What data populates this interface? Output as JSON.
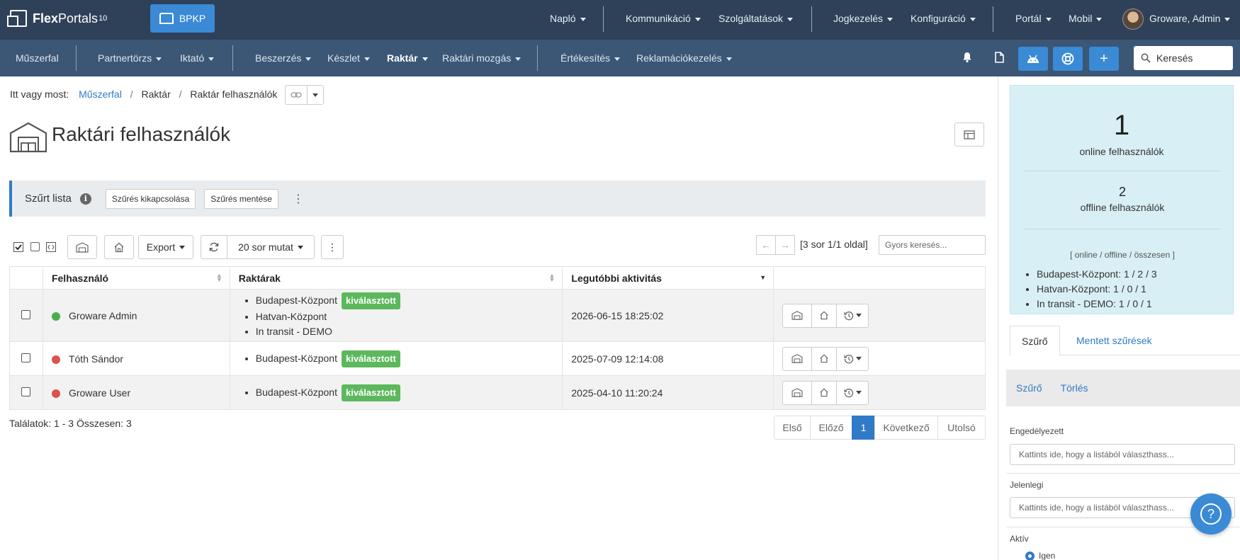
{
  "brand": {
    "name_bold": "Flex",
    "name_rest": "Portals",
    "version": "10"
  },
  "org_button": "BPKP",
  "topnav": [
    {
      "label": "Napló"
    },
    {
      "label": "Kommunikáció"
    },
    {
      "label": "Szolgáltatások"
    },
    {
      "label": "Jogkezelés"
    },
    {
      "label": "Konfiguráció"
    },
    {
      "label": "Portál"
    },
    {
      "label": "Mobil"
    },
    {
      "label": "Groware, Admin"
    }
  ],
  "subnav": [
    {
      "label": "Műszerfal"
    },
    {
      "label": "Partnertörzs"
    },
    {
      "label": "Iktató"
    },
    {
      "label": "Beszerzés"
    },
    {
      "label": "Készlet"
    },
    {
      "label": "Raktár"
    },
    {
      "label": "Raktári mozgás"
    },
    {
      "label": "Értékesítés"
    },
    {
      "label": "Reklamációkezelés"
    }
  ],
  "search": {
    "placeholder": "Keresés"
  },
  "breadcrumb": {
    "prefix": "Itt vagy most:",
    "items": [
      "Műszerfal",
      "Raktár",
      "Raktár felhasználók"
    ]
  },
  "page_title": "Raktári felhasználók",
  "filter_bar": {
    "label": "Szűrt lista",
    "disable_btn": "Szűrés kikapcsolása",
    "save_btn": "Szűrés mentése"
  },
  "toolbar": {
    "export": "Export",
    "rows": "20 sor mutat",
    "rowcount": "[3 sor 1/1 oldal]",
    "quick_search_placeholder": "Gyors keresés..."
  },
  "table": {
    "headers": [
      "Felhasználó",
      "Raktárak",
      "Legutóbbi aktivitás"
    ],
    "badge_text": "kiválasztott",
    "rows": [
      {
        "user": "Groware Admin",
        "status_color": "#4cae4c",
        "warehouses": [
          "Budapest-Központ",
          "Hatvan-Központ",
          "In transit - DEMO"
        ],
        "activity": "2026-06-15 18:25:02"
      },
      {
        "user": "Tóth Sándor",
        "status_color": "#d9534f",
        "warehouses": [
          "Budapest-Központ"
        ],
        "activity": "2025-07-09 12:14:08"
      },
      {
        "user": "Groware User",
        "status_color": "#d9534f",
        "warehouses": [
          "Budapest-Központ"
        ],
        "activity": "2025-04-10 11:20:24"
      }
    ]
  },
  "results": "Találatok: 1 - 3 Összesen: 3",
  "pagination": {
    "first": "Első",
    "prev": "Előző",
    "current": "1",
    "next": "Következő",
    "last": "Utolsó"
  },
  "stats": {
    "online_count": "1",
    "online_label": "online felhasználók",
    "offline_count": "2",
    "offline_label": "offline felhasználók",
    "legend": "[ online / offline / összesen ]",
    "warehouses": [
      "Budapest-Központ: 1 / 2 / 3",
      "Hatvan-Központ: 1 / 0 / 1",
      "In transit - DEMO: 1 / 0 / 1"
    ]
  },
  "right_tabs": {
    "filter": "Szűrő",
    "saved": "Mentett szűrések"
  },
  "filter_actions": {
    "filter": "Szűrő",
    "clear": "Törlés"
  },
  "fields": {
    "allowed_label": "Engedélyezett",
    "allowed_placeholder": "Kattints ide, hogy a listából választhass...",
    "current_label": "Jelenlegi",
    "current_placeholder": "Kattints ide, hogy a listából választhass...",
    "active_label": "Aktív",
    "active_option": "Igen"
  },
  "colors": {
    "topbar": "#2f4159",
    "subbar": "#3c5676",
    "accent": "#3a8ad6",
    "badge": "#5cb85c"
  }
}
